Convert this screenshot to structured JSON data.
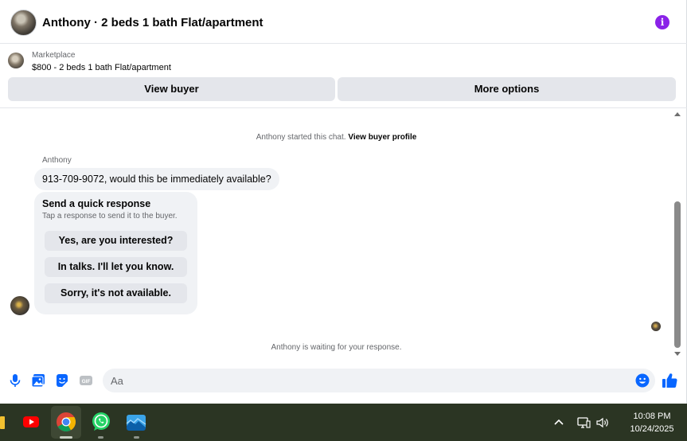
{
  "header": {
    "title": "Anthony · 2 beds 1 bath Flat/apartment",
    "info_icon": "info-icon",
    "accent": "#8a22e8"
  },
  "listing": {
    "source": "Marketplace",
    "title": "$800 - 2 beds 1 bath Flat/apartment"
  },
  "actions": {
    "view_buyer": "View buyer",
    "more_options": "More options"
  },
  "chat": {
    "started_text": "Anthony started this chat.",
    "view_profile_link": "View buyer profile",
    "sender": "Anthony",
    "message": "913-709-9072, would this be immediately available?",
    "quick_response": {
      "title": "Send a quick response",
      "subtitle": "Tap a response to send it to the buyer.",
      "options": [
        "Yes, are you interested?",
        "In talks. I'll let you know.",
        "Sorry, it's not available."
      ]
    },
    "waiting_text": "Anthony is waiting for your response."
  },
  "composer": {
    "placeholder": "Aa",
    "icons": [
      "microphone-icon",
      "photo-icon",
      "sticker-icon",
      "gif-icon",
      "emoji-icon",
      "like-icon"
    ],
    "accent": "#0866ff"
  },
  "taskbar": {
    "apps": [
      "youtube-icon",
      "chrome-icon",
      "whatsapp-icon",
      "photos-icon"
    ],
    "time": "10:08 PM",
    "date": "10/24/2025"
  }
}
